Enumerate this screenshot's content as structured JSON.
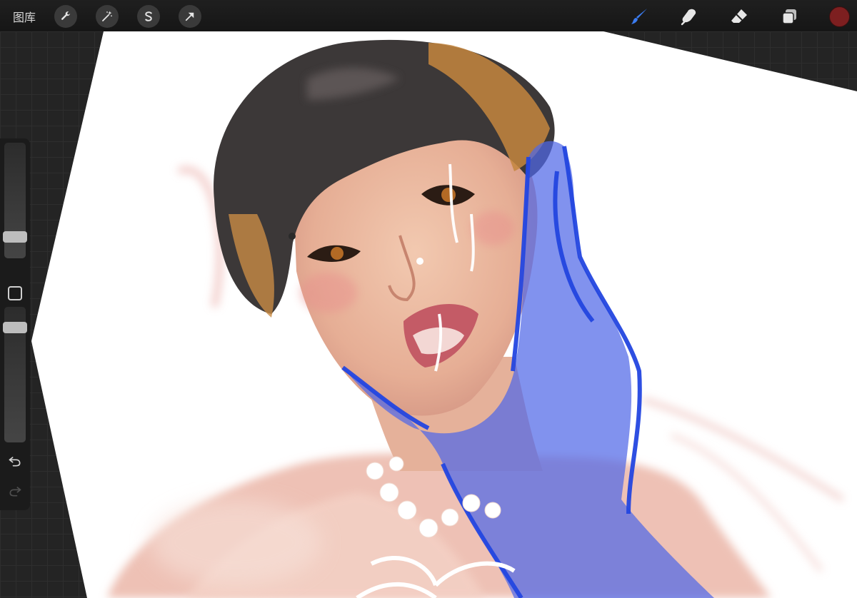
{
  "toolbar": {
    "gallery_label": "图库",
    "left_tools": [
      {
        "name": "actions",
        "icon": "wrench-icon"
      },
      {
        "name": "adjustments",
        "icon": "magic-wand-icon"
      },
      {
        "name": "selection",
        "icon": "selection-s-icon"
      },
      {
        "name": "transform",
        "icon": "arrow-cursor-icon"
      }
    ],
    "right_tools": [
      {
        "name": "brush",
        "icon": "brush-icon",
        "active": true
      },
      {
        "name": "smudge",
        "icon": "smudge-finger-icon"
      },
      {
        "name": "eraser",
        "icon": "eraser-icon"
      },
      {
        "name": "layers",
        "icon": "layers-icon"
      }
    ],
    "current_color": "#7d1f20",
    "active_tool_color": "#3b7cf0"
  },
  "sidebar": {
    "brush_size_level": 0.15,
    "opacity_level": 0.88,
    "modify_icon": "square-icon",
    "undo_icon": "undo-icon",
    "redo_icon": "redo-icon"
  },
  "canvas": {
    "grid_color": "#2e2e2e",
    "paper_color": "#ffffff"
  }
}
